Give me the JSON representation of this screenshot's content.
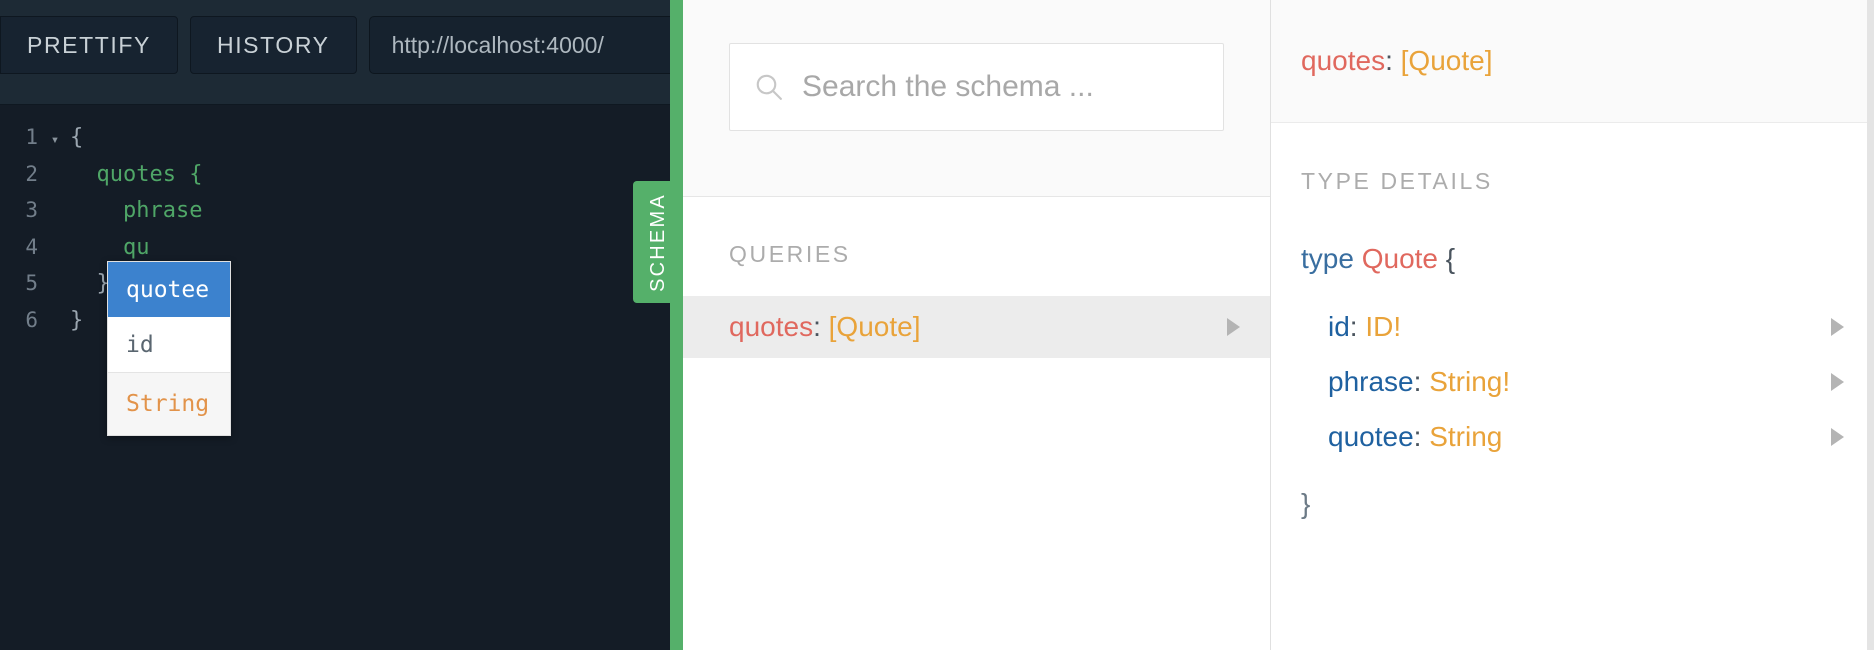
{
  "editor": {
    "toolbar": {
      "prettify_label": "PRETTIFY",
      "history_label": "HISTORY",
      "url_value": "http://localhost:4000/"
    },
    "query_lines": [
      {
        "number": "1",
        "fold": "▾",
        "text": "{"
      },
      {
        "number": "2",
        "fold": "",
        "text": "  quotes {"
      },
      {
        "number": "3",
        "fold": "",
        "text": "    phrase"
      },
      {
        "number": "4",
        "fold": "",
        "text": "    qu"
      },
      {
        "number": "5",
        "fold": "",
        "text": "  }"
      },
      {
        "number": "6",
        "fold": "",
        "text": "}"
      }
    ],
    "autocomplete": {
      "items": [
        {
          "label": "quotee",
          "selected": true
        },
        {
          "label": "id",
          "selected": false
        }
      ],
      "hint": "String"
    },
    "schema_tab_label": "SCHEMA",
    "colors": {
      "background": "#141C26",
      "toolbar_background": "#1D2A35",
      "field_token": "#4FA667",
      "gutter_text": "#727E8A",
      "accent_green": "#55B06A",
      "autocomplete_selected": "#3C82CE"
    }
  },
  "docs": {
    "search": {
      "placeholder": "Search the schema ...",
      "value": "",
      "icon": "search-icon"
    },
    "section_title": "QUERIES",
    "entries": [
      {
        "name": "quotes",
        "separator": ":",
        "type": "[Quote]",
        "expand_icon": "triangle-right-icon",
        "selected": true
      }
    ]
  },
  "type_detail": {
    "header": {
      "name": "quotes",
      "separator": ":",
      "type": "[Quote]"
    },
    "section_title": "TYPE DETAILS",
    "signature": {
      "keyword": "type",
      "name": "Quote",
      "open_brace": "{",
      "close_brace": "}"
    },
    "fields": [
      {
        "name": "id",
        "separator": ":",
        "type": "ID!",
        "expand_icon": "triangle-right-icon"
      },
      {
        "name": "phrase",
        "separator": ":",
        "type": "String!",
        "expand_icon": "triangle-right-icon"
      },
      {
        "name": "quotee",
        "separator": ":",
        "type": "String",
        "expand_icon": "triangle-right-icon"
      }
    ],
    "colors": {
      "field_name": "#1F61A0",
      "type_name": "#E9A33A",
      "object_type": "#E0685E",
      "keyword": "#396EA0"
    }
  }
}
